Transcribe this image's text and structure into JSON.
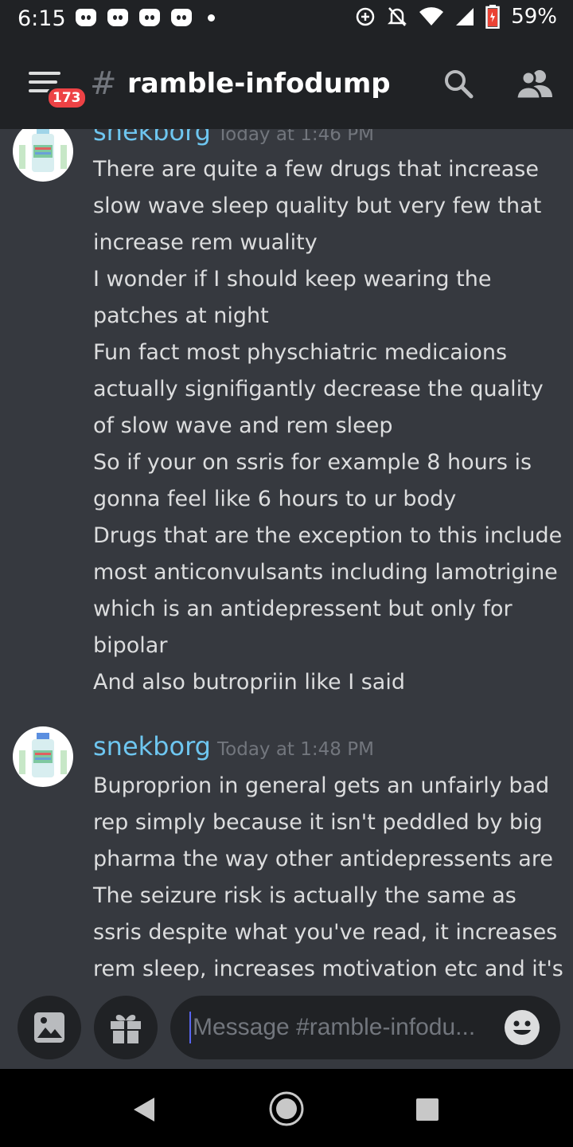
{
  "status_bar": {
    "time": "6:15",
    "battery": "59%",
    "notification_icons": [
      "discord-icon",
      "discord-icon",
      "discord-icon",
      "discord-icon"
    ]
  },
  "header": {
    "notification_count": "173",
    "channel_prefix": "#",
    "channel_name": "ramble-infodump"
  },
  "messages": [
    {
      "author": "snekborg",
      "timestamp": "Today at 1:46 PM",
      "lines": [
        "There are quite a few drugs that increase",
        "slow wave sleep quality but very few that",
        "increase rem wuality",
        "I wonder if I should keep wearing the",
        "patches at night",
        "Fun fact most physchiatric medicaions",
        "actually signifigantly decrease the quality",
        "of slow wave and rem sleep",
        "So if your on ssris for example 8 hours is",
        "gonna feel like 6 hours to ur body",
        "Drugs that are the exception to this include",
        "most anticonvulsants including lamotrigine",
        "which is an antidepressent but only for",
        "bipolar",
        "And also butropriin like I said"
      ]
    },
    {
      "author": "snekborg",
      "timestamp": "Today at 1:48 PM",
      "lines": [
        "Buproprion in general gets an unfairly bad",
        "rep simply because it isn't peddled by big",
        "pharma the way other antidepressents are",
        "The seizure risk is actually the same as",
        "ssris despite what you've read, it increases",
        "rem sleep, increases motivation etc and it's"
      ]
    }
  ],
  "composer": {
    "placeholder": "Message #ramble-infodu..."
  },
  "colors": {
    "background": "#36393f",
    "header": "#202225",
    "username": "#6ec6f0",
    "badge": "#ed4245"
  }
}
